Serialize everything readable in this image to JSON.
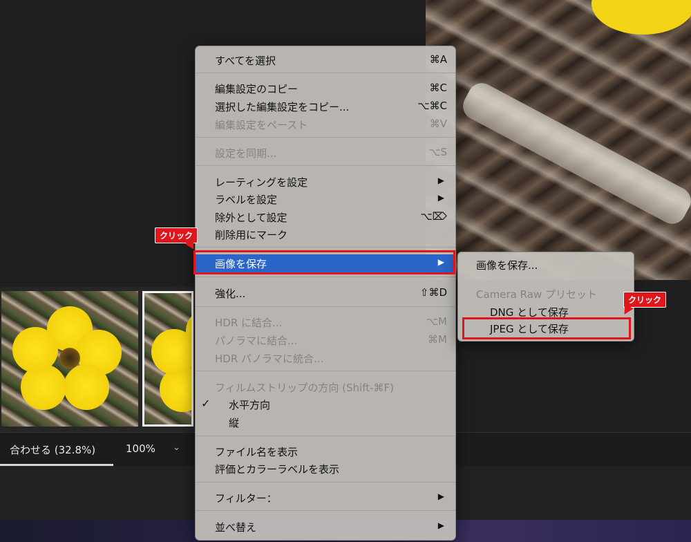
{
  "zoom_bar": {
    "fit_label": "合わせる (32.8%)",
    "percent_label": "100%",
    "caret": "⌄"
  },
  "context_menu": {
    "items": [
      {
        "label": "すべてを選択",
        "shortcut": "⌘A",
        "enabled": true
      },
      {
        "label": "編集設定のコピー",
        "shortcut": "⌘C",
        "enabled": true
      },
      {
        "label": "選択した編集設定をコピー...",
        "shortcut": "⌥⌘C",
        "enabled": true
      },
      {
        "label": "編集設定をペースト",
        "shortcut": "⌘V",
        "enabled": false
      },
      {
        "label": "設定を同期...",
        "shortcut": "⌥S",
        "enabled": false
      },
      {
        "label": "レーティングを設定",
        "submenu": true,
        "enabled": true
      },
      {
        "label": "ラベルを設定",
        "submenu": true,
        "enabled": true
      },
      {
        "label": "除外として設定",
        "shortcut": "⌥⌦",
        "enabled": true
      },
      {
        "label": "削除用にマーク",
        "enabled": true
      },
      {
        "label": "画像を保存",
        "submenu": true,
        "enabled": true,
        "highlighted": true
      },
      {
        "label": "強化...",
        "shortcut": "⇧⌘D",
        "enabled": true
      },
      {
        "label": "HDR に結合...",
        "shortcut": "⌥M",
        "enabled": false
      },
      {
        "label": "パノラマに結合...",
        "shortcut": "⌘M",
        "enabled": false
      },
      {
        "label": "HDR パノラマに統合...",
        "enabled": false
      },
      {
        "label": "フィルムストリップの方向 (Shift-⌘F)",
        "enabled": false
      },
      {
        "label": "水平方向",
        "enabled": true,
        "checked": true
      },
      {
        "label": "縦",
        "enabled": true
      },
      {
        "label": "ファイル名を表示",
        "enabled": true
      },
      {
        "label": "評価とカラーラベルを表示",
        "enabled": true
      },
      {
        "label": "フィルター：",
        "submenu": true,
        "enabled": true
      },
      {
        "label": "並べ替え",
        "submenu": true,
        "enabled": true
      }
    ],
    "check_mark": "✓",
    "submenu_arrow": "▶"
  },
  "submenu": {
    "save_image": "画像を保存...",
    "preset_header": "Camera Raw プリセット",
    "save_dng": "DNG として保存",
    "save_jpeg": "JPEG として保存"
  },
  "annotations": {
    "callout_1": "クリック",
    "callout_2": "クリック",
    "accent_color": "#e0161d"
  },
  "colors": {
    "menu_highlight": "#2a66c9",
    "flower_yellow": "#f3d10e"
  }
}
